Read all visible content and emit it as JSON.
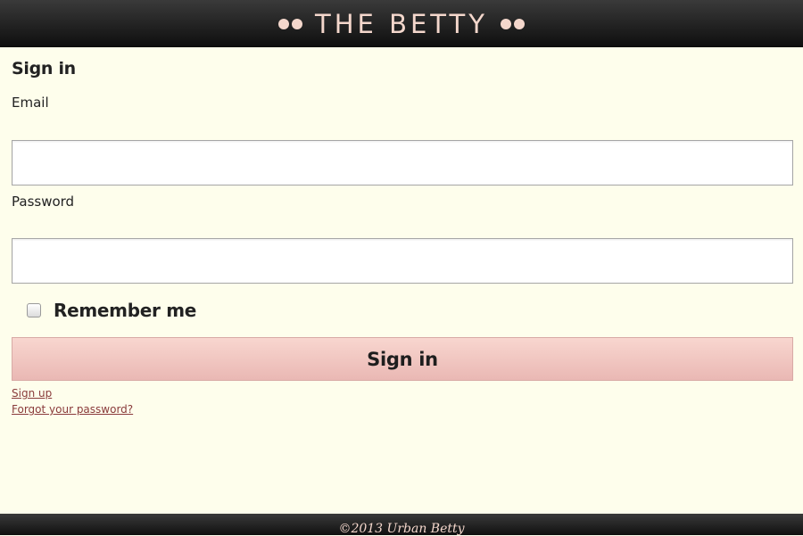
{
  "header": {
    "brand": "THE BETTY"
  },
  "form": {
    "title": "Sign in",
    "email_label": "Email",
    "email_value": "",
    "password_label": "Password",
    "password_value": "",
    "remember_label": "Remember me",
    "remember_checked": false,
    "submit_label": "Sign in"
  },
  "links": {
    "sign_up": "Sign up",
    "forgot": "Forgot your password?"
  },
  "footer": {
    "text": "©2013 Urban Betty"
  },
  "colors": {
    "page_bg": "#fefeec",
    "header_bg": "#1a1a1a",
    "brand": "#f4d7cc",
    "button": "#f0c6c0",
    "link": "#8a3b3b"
  }
}
